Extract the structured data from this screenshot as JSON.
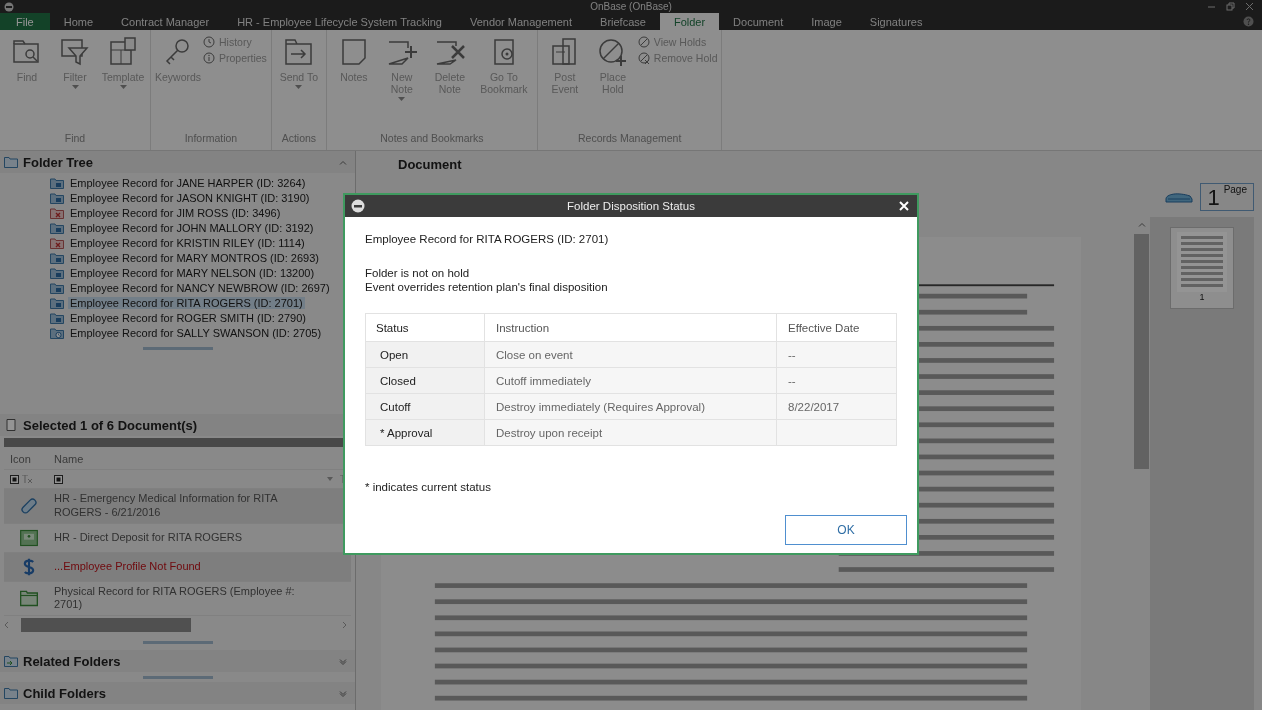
{
  "window": {
    "title": "OnBase (OnBase)"
  },
  "ribbon_tabs": [
    {
      "label": "File",
      "kind": "file",
      "selected": false
    },
    {
      "label": "Home",
      "kind": "tab",
      "selected": false
    },
    {
      "label": "Contract Manager",
      "kind": "tab",
      "selected": false
    },
    {
      "label": "HR - Employee Lifecycle System Tracking",
      "kind": "tab",
      "selected": false
    },
    {
      "label": "Vendor Management",
      "kind": "tab",
      "selected": false
    },
    {
      "label": "Briefcase",
      "kind": "tab",
      "selected": false
    },
    {
      "label": "Folder",
      "kind": "tab",
      "selected": true
    },
    {
      "label": "Document",
      "kind": "tab",
      "selected": false
    },
    {
      "label": "Image",
      "kind": "tab",
      "selected": false
    },
    {
      "label": "Signatures",
      "kind": "tab",
      "selected": false
    }
  ],
  "ribbon_groups": [
    {
      "label": "Find",
      "buttons": [
        {
          "label": "Find",
          "kind": "folder-search",
          "menu": false,
          "disabled": true
        },
        {
          "label": "Filter",
          "kind": "funnel",
          "menu": true,
          "disabled": true
        },
        {
          "label": "Template",
          "kind": "template",
          "menu": true,
          "disabled": true
        }
      ]
    },
    {
      "label": "Information",
      "buttons": [
        {
          "label": "Keywords",
          "kind": "key",
          "menu": false,
          "disabled": true
        }
      ],
      "small_buttons": [
        {
          "label": "History",
          "kind": "clock",
          "disabled": true
        },
        {
          "label": "Properties",
          "kind": "info",
          "disabled": true
        }
      ]
    },
    {
      "label": "Actions",
      "buttons": [
        {
          "label": "Send To",
          "kind": "send",
          "menu": true,
          "disabled": true
        }
      ]
    },
    {
      "label": "Notes and Bookmarks",
      "buttons": [
        {
          "label": "Notes",
          "kind": "note",
          "menu": false,
          "disabled": true
        },
        {
          "label": "New Note",
          "kind": "note-plus",
          "menu": true,
          "disabled": true
        },
        {
          "label": "Delete Note",
          "kind": "note-x",
          "menu": false,
          "disabled": true
        },
        {
          "label": "Go To Bookmark",
          "kind": "bookmark",
          "menu": false,
          "disabled": true
        }
      ]
    },
    {
      "label": "Records Management",
      "buttons": [
        {
          "label": "Post Event",
          "kind": "post",
          "menu": false,
          "disabled": true
        },
        {
          "label": "Place Hold",
          "kind": "hold",
          "menu": false,
          "disabled": true
        }
      ],
      "small_buttons": [
        {
          "label": "View Holds",
          "kind": "view-holds",
          "disabled": true
        },
        {
          "label": "Remove Hold",
          "kind": "remove-hold",
          "disabled": true
        }
      ]
    }
  ],
  "folder_tree": {
    "title": "Folder Tree",
    "items": [
      {
        "label": "Employee Record for JANE HARPER (ID: 3264)",
        "kind": "folder",
        "selected": false
      },
      {
        "label": "Employee Record for JASON KNIGHT (ID: 3190)",
        "kind": "folder",
        "selected": false
      },
      {
        "label": "Employee Record for JIM ROSS (ID: 3496)",
        "kind": "destroyed",
        "selected": false
      },
      {
        "label": "Employee Record for JOHN MALLORY (ID: 3192)",
        "kind": "folder",
        "selected": false
      },
      {
        "label": "Employee Record for KRISTIN RILEY (ID: 1114)",
        "kind": "destroyed",
        "selected": false
      },
      {
        "label": "Employee Record for MARY MONTROS (ID: 2693)",
        "kind": "folder",
        "selected": false
      },
      {
        "label": "Employee Record for MARY NELSON (ID: 13200)",
        "kind": "folder",
        "selected": false
      },
      {
        "label": "Employee Record for NANCY NEWBROW (ID: 2697)",
        "kind": "folder",
        "selected": false
      },
      {
        "label": "Employee Record for RITA ROGERS (ID: 2701)",
        "kind": "folder",
        "selected": true
      },
      {
        "label": "Employee Record for ROGER SMITH (ID: 2790)",
        "kind": "folder",
        "selected": false
      },
      {
        "label": "Employee Record for SALLY SWANSON (ID: 2705)",
        "kind": "scheduled",
        "selected": false
      }
    ]
  },
  "documents": {
    "title": "Selected 1 of 6 Document(s)",
    "columns": [
      "Icon",
      "Name"
    ],
    "rows": [
      {
        "kind": "bandage",
        "name": "HR - Emergency Medical Information for RITA ROGERS - 6/21/2016",
        "error": false
      },
      {
        "kind": "deposit",
        "name": "HR - Direct Deposit for RITA ROGERS",
        "error": false
      },
      {
        "kind": "dollar",
        "name": "...Employee Profile Not Found",
        "error": true
      },
      {
        "kind": "folder",
        "name": "Physical Record for RITA ROGERS (Employee #: 2701)",
        "error": false
      }
    ]
  },
  "related_folders": {
    "title": "Related Folders"
  },
  "child_folders": {
    "title": "Child Folders"
  },
  "document_view": {
    "title": "Document",
    "page_count": "1",
    "page_label": "Page",
    "thumbnails": [
      {
        "label": "1"
      }
    ]
  },
  "dialog": {
    "title": "Folder Disposition Status",
    "folder": "Employee Record for RITA ROGERS (ID: 2701)",
    "messages": [
      "Folder is not on hold",
      "Event overrides retention plan's final disposition"
    ],
    "columns": [
      "Status",
      "Instruction",
      "Effective Date"
    ],
    "rows": [
      {
        "status": "Open",
        "instruction": "Close on event",
        "date": "--"
      },
      {
        "status": "Closed",
        "instruction": "Cutoff immediately",
        "date": "--"
      },
      {
        "status": "Cutoff",
        "instruction": "Destroy immediately (Requires Approval)",
        "date": "8/22/2017"
      },
      {
        "status": "* Approval",
        "instruction": "Destroy upon receipt",
        "date": ""
      }
    ],
    "footnote": "* indicates current status",
    "ok": "OK"
  }
}
